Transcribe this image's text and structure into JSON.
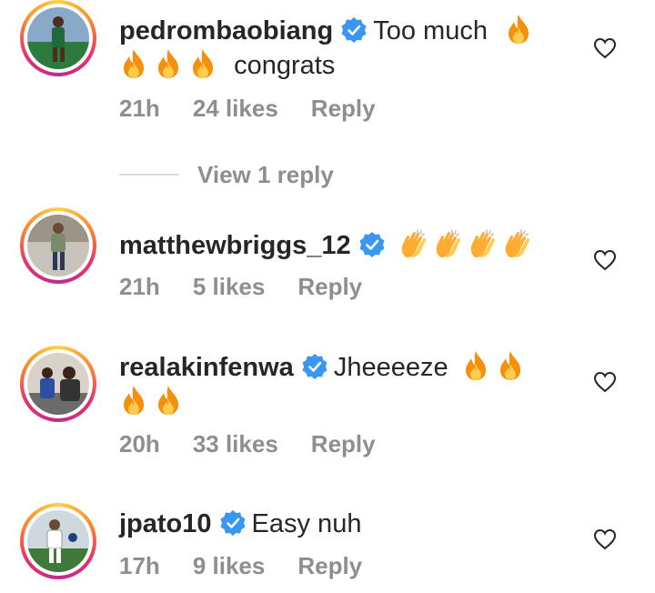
{
  "comments": [
    {
      "username": "pedrombaobiang",
      "verified": true,
      "text_before": "Too much",
      "text_after": "congrats",
      "emojis_line1": [
        "fire"
      ],
      "emojis_line2": [
        "fire",
        "fire",
        "fire"
      ],
      "time": "21h",
      "likes": "24 likes",
      "reply": "Reply",
      "view_replies": "View 1 reply"
    },
    {
      "username": "matthewbriggs_12",
      "verified": true,
      "emojis_line1": [
        "clapping-hands",
        "clapping-hands",
        "clapping-hands",
        "clapping-hands"
      ],
      "time": "21h",
      "likes": "5 likes",
      "reply": "Reply"
    },
    {
      "username": "realakinfenwa",
      "verified": true,
      "text_before": "Jheeeeze",
      "emojis_line1": [
        "fire",
        "fire"
      ],
      "emojis_line2": [
        "fire",
        "fire"
      ],
      "time": "20h",
      "likes": "33 likes",
      "reply": "Reply"
    },
    {
      "username": "jpato10",
      "verified": true,
      "text_before": "Easy nuh",
      "time": "17h",
      "likes": "9 likes",
      "reply": "Reply"
    }
  ],
  "icons": {
    "verified_badge": "verified-badge-icon",
    "like": "heart-icon",
    "fire": "fire-emoji",
    "clap": "clapping-hands-emoji"
  },
  "colors": {
    "text": "#262626",
    "secondary_text": "#8e8e8e",
    "verified_blue": "#3897f0",
    "story_ring_start": "#fdd24a",
    "story_ring_end": "#c02b8f"
  }
}
